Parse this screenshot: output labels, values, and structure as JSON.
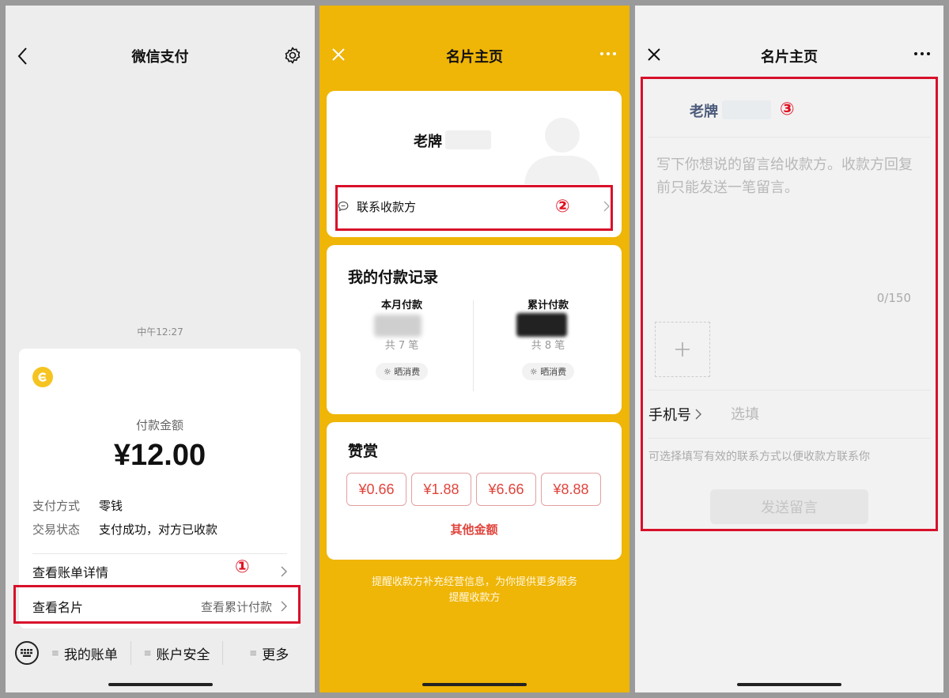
{
  "panel1": {
    "title": "微信支付",
    "timestamp": "中午12:27",
    "amount_label": "付款金额",
    "amount": "¥12.00",
    "pay_method_key": "支付方式",
    "pay_method_value": "零钱",
    "status_key": "交易状态",
    "status_value": "支付成功，对方已收款",
    "bill_detail": "查看账单详情",
    "card_label": "查看名片",
    "card_sub": "查看累计付款",
    "marker": "①",
    "bottom": [
      "我的账单",
      "账户安全",
      "更多"
    ]
  },
  "panel2": {
    "title": "名片主页",
    "name": "老牌",
    "contact": "联系收款方",
    "marker": "②",
    "records_title": "我的付款记录",
    "month_label": "本月付款",
    "month_count": "共 7 笔",
    "total_label": "累计付款",
    "total_count": "共 8 笔",
    "share": "晒消费",
    "tips_title": "赞赏",
    "tips": [
      "¥0.66",
      "¥1.88",
      "¥6.66",
      "¥8.88"
    ],
    "other": "其他金额",
    "notice_line1": "提醒收款方补充经营信息，为你提供更多服务",
    "notice_line2": "提醒收款方"
  },
  "panel3": {
    "title": "名片主页",
    "name": "老牌",
    "marker": "③",
    "message_placeholder": "写下你想说的留言给收款方。收款方回复前只能发送一笔留言。",
    "counter": "0/150",
    "phone_label": "手机号",
    "phone_placeholder": "选填",
    "hint": "可选择填写有效的联系方式以便收款方联系你",
    "send": "发送留言"
  },
  "colors": {
    "yellow_bg": "#efb507",
    "highlight": "#d8102a",
    "tip_red": "#e0443c"
  }
}
